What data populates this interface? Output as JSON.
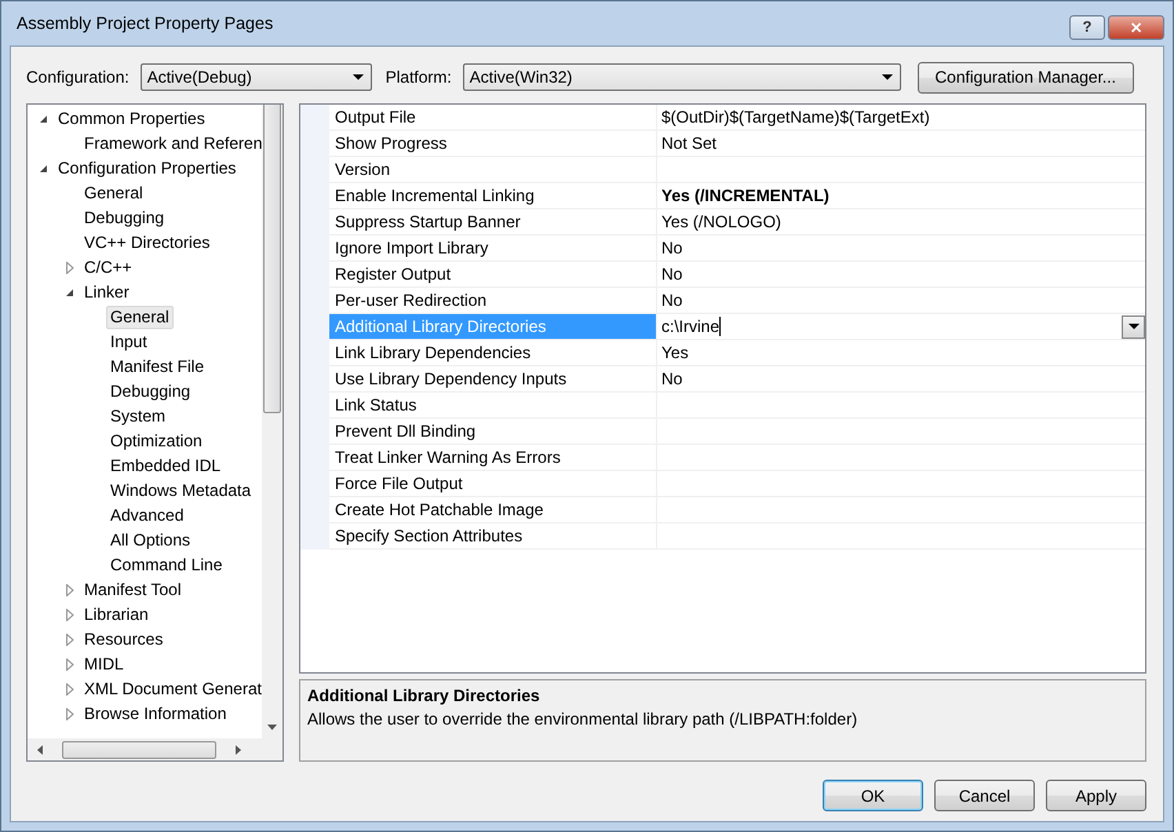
{
  "window": {
    "title": "Assembly Project Property Pages",
    "buttons": [
      "?",
      "✕"
    ]
  },
  "configuration": {
    "label": "Configuration:",
    "value": "Active(Debug)"
  },
  "platform": {
    "label": "Platform:",
    "value": "Active(Win32)"
  },
  "configuration_manager_button": "Configuration Manager...",
  "tree": [
    {
      "label": "Common Properties",
      "expanded": true,
      "selected": false,
      "children": [
        {
          "label": "Framework and Referen",
          "selected": false
        }
      ]
    },
    {
      "label": "Configuration Properties",
      "expanded": true,
      "selected": false,
      "children": [
        {
          "label": "General",
          "selected": false
        },
        {
          "label": "Debugging",
          "selected": false
        },
        {
          "label": "VC++ Directories",
          "selected": false
        },
        {
          "label": "C/C++",
          "expanded": false,
          "selected": false
        },
        {
          "label": "Linker",
          "expanded": true,
          "selected": false,
          "children": [
            {
              "label": "General",
              "selected": true
            },
            {
              "label": "Input",
              "selected": false
            },
            {
              "label": "Manifest File",
              "selected": false
            },
            {
              "label": "Debugging",
              "selected": false
            },
            {
              "label": "System",
              "selected": false
            },
            {
              "label": "Optimization",
              "selected": false
            },
            {
              "label": "Embedded IDL",
              "selected": false
            },
            {
              "label": "Windows Metadata",
              "selected": false
            },
            {
              "label": "Advanced",
              "selected": false
            },
            {
              "label": "All Options",
              "selected": false
            },
            {
              "label": "Command Line",
              "selected": false
            }
          ]
        },
        {
          "label": "Manifest Tool",
          "expanded": false,
          "selected": false
        },
        {
          "label": "Librarian",
          "expanded": false,
          "selected": false
        },
        {
          "label": "Resources",
          "expanded": false,
          "selected": false
        },
        {
          "label": "MIDL",
          "expanded": false,
          "selected": false
        },
        {
          "label": "XML Document Generat",
          "expanded": false,
          "selected": false
        },
        {
          "label": "Browse Information",
          "expanded": false,
          "selected": false
        }
      ]
    }
  ],
  "properties": [
    {
      "name": "Output File",
      "value": "$(OutDir)$(TargetName)$(TargetExt)",
      "selected": false
    },
    {
      "name": "Show Progress",
      "value": "Not Set",
      "selected": false
    },
    {
      "name": "Version",
      "selected": false
    },
    {
      "name": "Enable Incremental Linking",
      "value": "Yes (/INCREMENTAL)",
      "bold": true,
      "selected": false
    },
    {
      "name": "Suppress Startup Banner",
      "value": "Yes (/NOLOGO)",
      "selected": false
    },
    {
      "name": "Ignore Import Library",
      "value": "No",
      "selected": false
    },
    {
      "name": "Register Output",
      "value": "No",
      "selected": false
    },
    {
      "name": "Per-user Redirection",
      "value": "No",
      "selected": false
    },
    {
      "name": "Additional Library Directories",
      "value": "c:\\Irvine",
      "selected": true
    },
    {
      "name": "Link Library Dependencies",
      "value": "Yes",
      "selected": false
    },
    {
      "name": "Use Library Dependency Inputs",
      "value": "No",
      "selected": false
    },
    {
      "name": "Link Status",
      "selected": false
    },
    {
      "name": "Prevent Dll Binding",
      "selected": false
    },
    {
      "name": "Treat Linker Warning As Errors",
      "selected": false
    },
    {
      "name": "Force File Output",
      "selected": false
    },
    {
      "name": "Create Hot Patchable Image",
      "selected": false
    },
    {
      "name": "Specify Section Attributes",
      "selected": false
    }
  ],
  "description": {
    "title": "Additional Library Directories",
    "text": "Allows the user to override the environmental library path (/LIBPATH:folder)"
  },
  "buttons": [
    {
      "label": "OK",
      "default": true
    },
    {
      "label": "Cancel",
      "default": false
    },
    {
      "label": "Apply",
      "default": false
    }
  ]
}
